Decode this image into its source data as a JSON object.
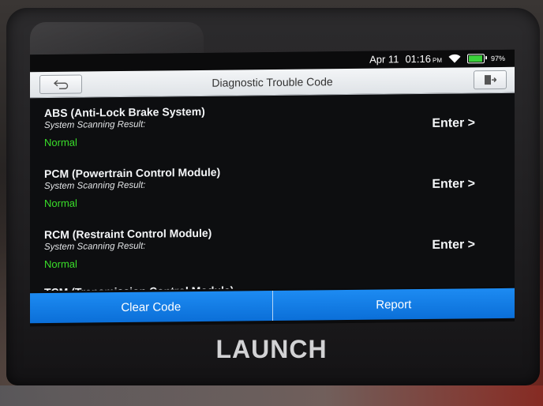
{
  "device": {
    "brand": "LAUNCH"
  },
  "statusbar": {
    "date": "Apr 11",
    "time": "01:16",
    "time_suffix": "PM",
    "battery_percent": "97%",
    "battery_level": 0.97
  },
  "header": {
    "title": "Diagnostic Trouble Code"
  },
  "systems": [
    {
      "name": "ABS (Anti-Lock Brake System)",
      "label": "System Scanning Result:",
      "status": "Normal",
      "enter_label": "Enter >"
    },
    {
      "name": "PCM (Powertrain Control Module)",
      "label": "System Scanning Result:",
      "status": "Normal",
      "enter_label": "Enter >"
    },
    {
      "name": "RCM (Restraint Control Module)",
      "label": "System Scanning Result:",
      "status": "Normal",
      "enter_label": "Enter >"
    },
    {
      "name": "TCM (Transmission Control Module)"
    }
  ],
  "footer": {
    "clear_label": "Clear Code",
    "report_label": "Report"
  },
  "colors": {
    "accent": "#1d8bf2",
    "normal": "#3adf2a"
  }
}
